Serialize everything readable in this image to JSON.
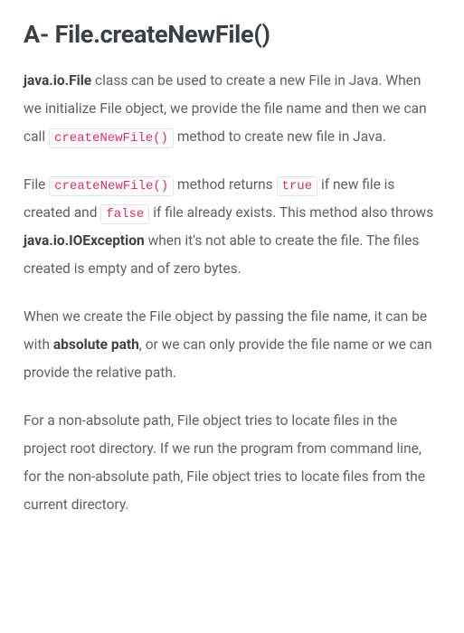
{
  "heading": "A- File.createNewFile()",
  "p1": {
    "b1": "java.io.File",
    "t1": " class can be used to create a new File in Java. When we initialize File object, we provide the file name and then we can call ",
    "c1": "createNewFile()",
    "t2": " method to create new file in Java."
  },
  "p2": {
    "t1": "File ",
    "c1": "createNewFile()",
    "t2": " method returns ",
    "c2": "true",
    "t3": " if new file is created and ",
    "c3": "false",
    "t4": " if file already exists. This method also throws ",
    "b1": "java.io.IOException",
    "t5": " when it's not able to create the file. The files created is empty and of zero bytes."
  },
  "p3": {
    "t1": "When we create the File object by passing the file name, it can be with ",
    "b1": "absolute path",
    "t2": ", or we can only provide the file name or we can provide the relative path."
  },
  "p4": {
    "t1": "For a non-absolute path, File object tries to locate files in the project root directory. If we run the program from command line, for the non-absolute path, File object tries to locate files from the current directory."
  }
}
